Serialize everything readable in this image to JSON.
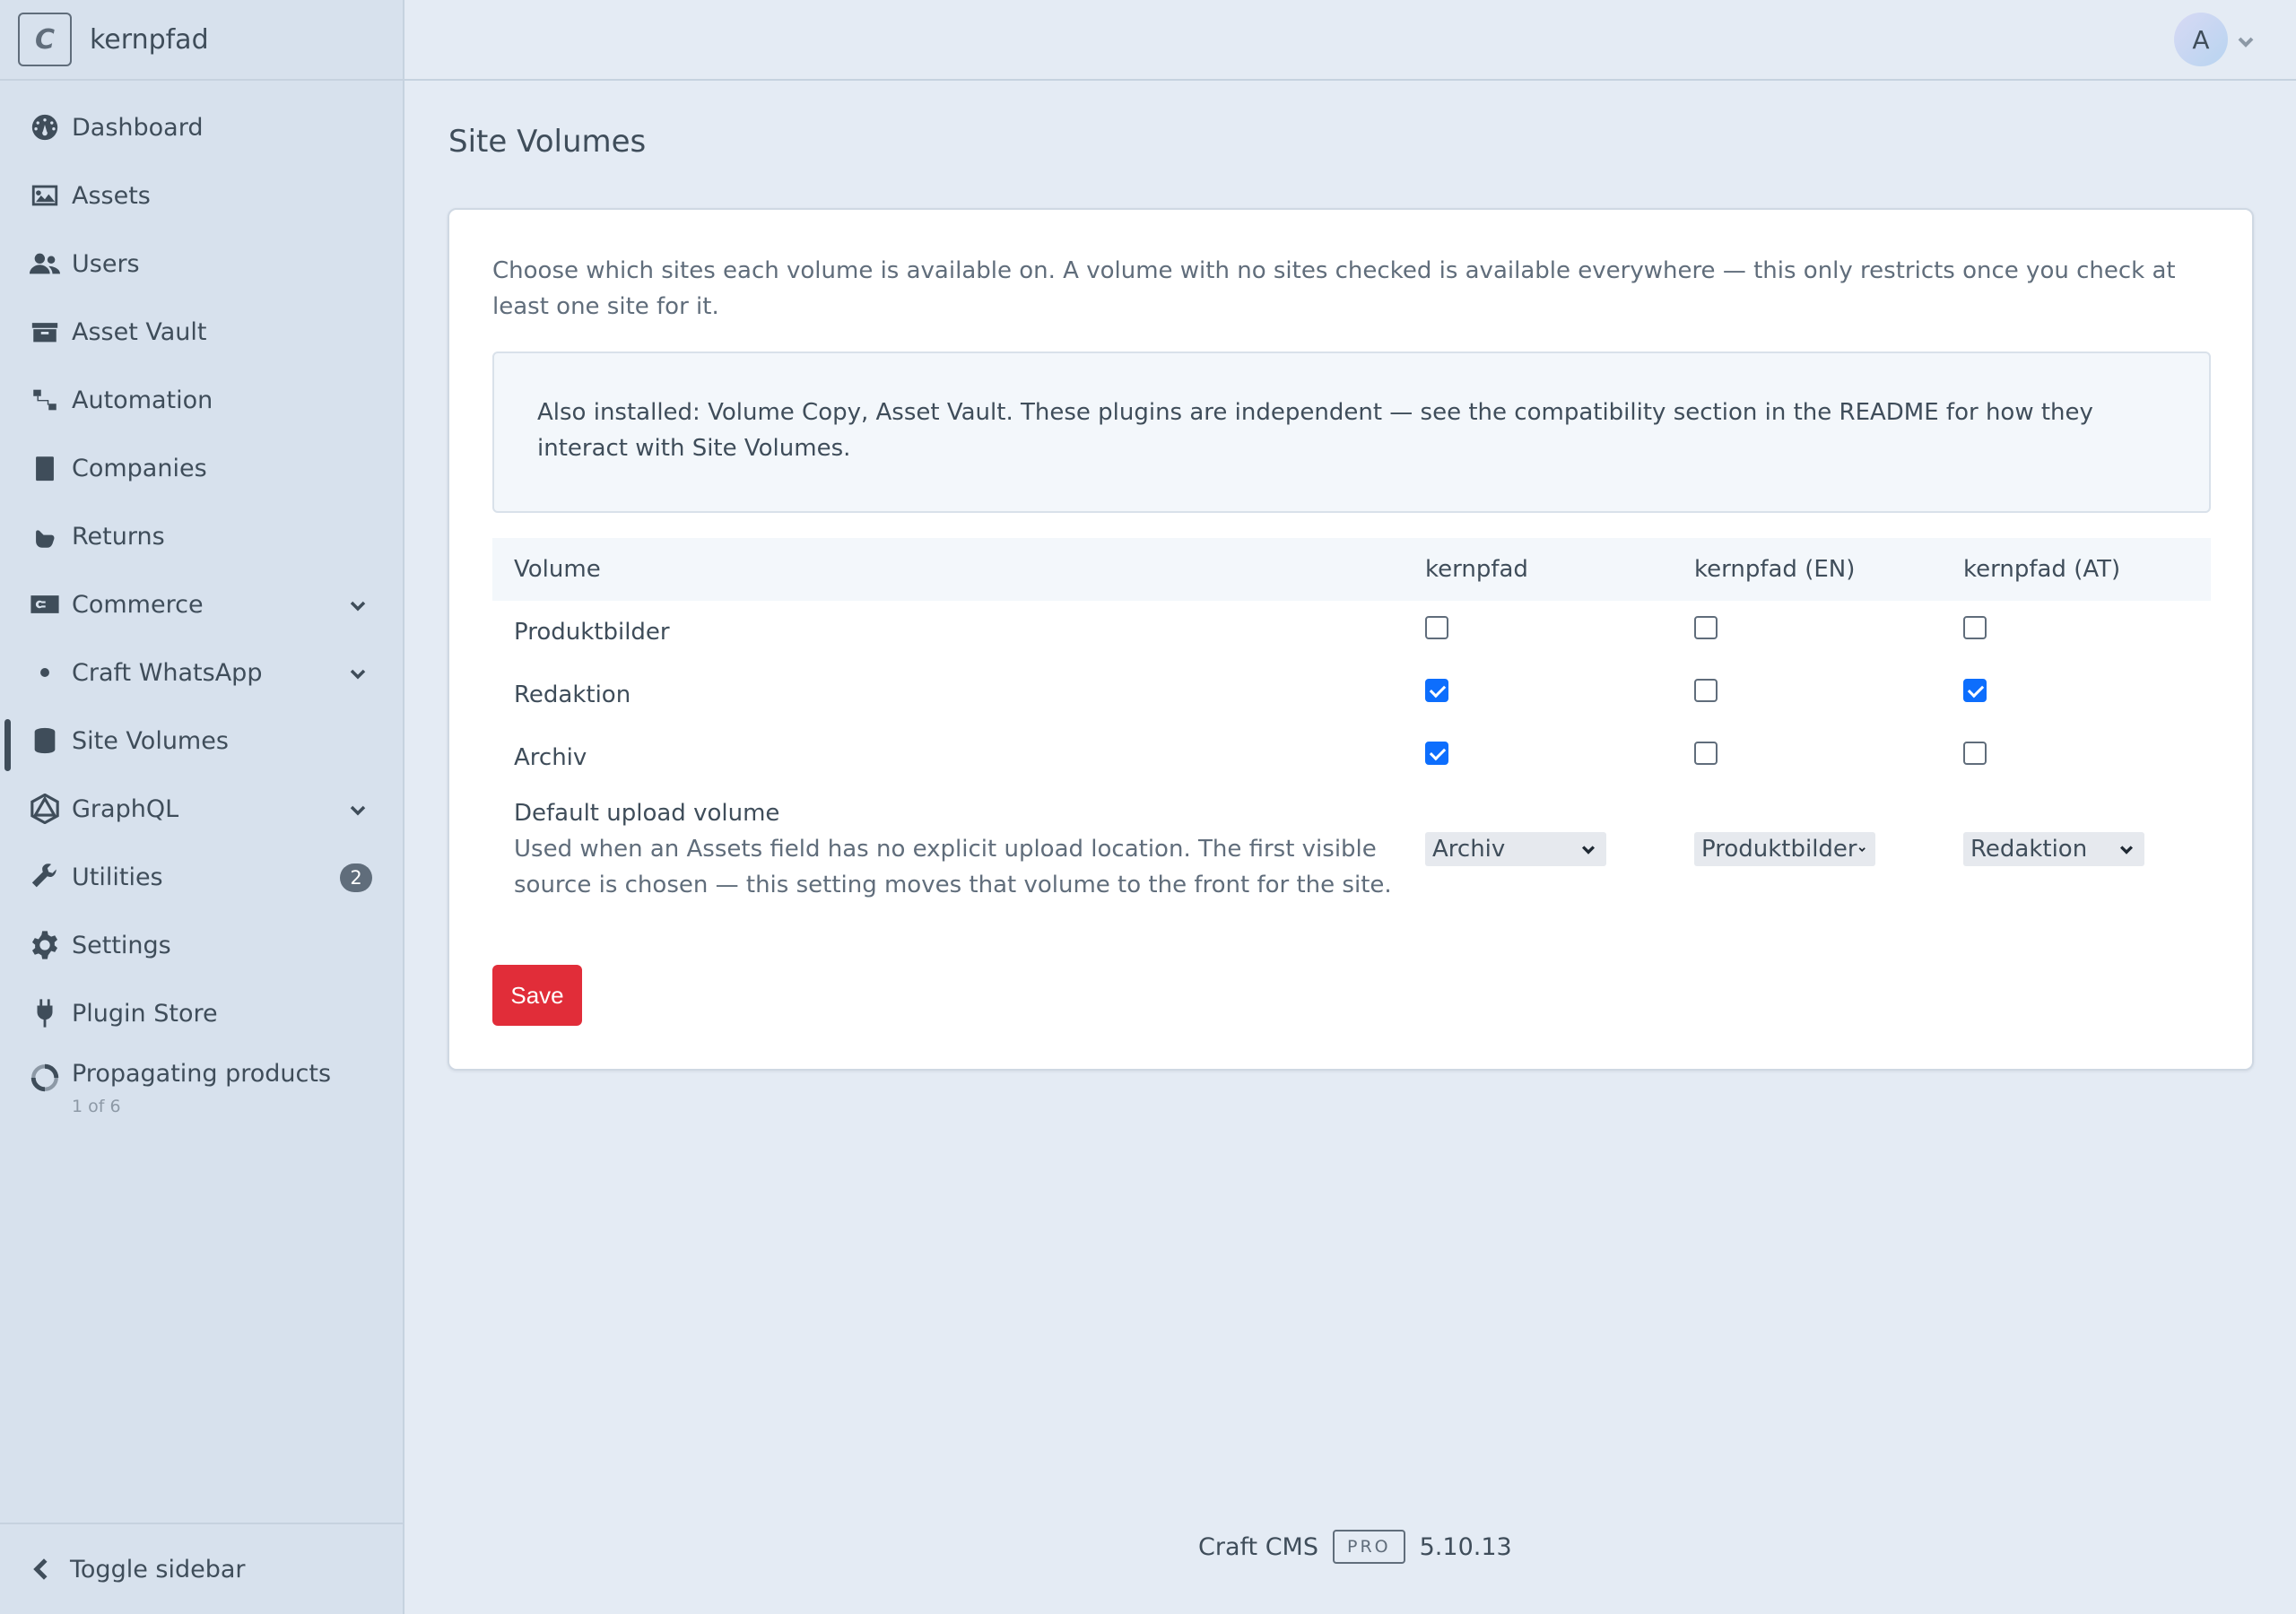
{
  "sidebar": {
    "logo_letter": "C",
    "site_name": "kernpfad",
    "items": [
      {
        "label": "Dashboard",
        "icon": "gauge-icon"
      },
      {
        "label": "Assets",
        "icon": "image-icon"
      },
      {
        "label": "Users",
        "icon": "users-icon"
      },
      {
        "label": "Asset Vault",
        "icon": "archive-icon"
      },
      {
        "label": "Automation",
        "icon": "workflow-icon"
      },
      {
        "label": "Companies",
        "icon": "building-icon"
      },
      {
        "label": "Returns",
        "icon": "hand-icon"
      },
      {
        "label": "Commerce",
        "icon": "commerce-icon"
      },
      {
        "label": "Craft WhatsApp",
        "icon": "dot-icon"
      },
      {
        "label": "Site Volumes",
        "icon": "database-icon"
      },
      {
        "label": "GraphQL",
        "icon": "graphql-icon"
      },
      {
        "label": "Utilities",
        "icon": "wrench-icon",
        "badge": "2"
      },
      {
        "label": "Settings",
        "icon": "gear-icon"
      },
      {
        "label": "Plugin Store",
        "icon": "plug-icon"
      }
    ],
    "job": {
      "title": "Propagating products",
      "progress": "1 of 6"
    },
    "toggle_label": "Toggle sidebar"
  },
  "header": {
    "avatar_letter": "A"
  },
  "main": {
    "title": "Site Volumes",
    "intro": "Choose which sites each volume is available on. A volume with no sites checked is available everywhere — this only restricts once you check at least one site for it.",
    "notice": "Also installed: Volume Copy, Asset Vault. These plugins are independent — see the compatibility section in the README for how they interact with Site Volumes.",
    "table": {
      "headers": [
        "Volume",
        "kernpfad",
        "kernpfad (EN)",
        "kernpfad (AT)"
      ],
      "rows": [
        {
          "name": "Produktbilder",
          "checks": [
            false,
            false,
            false
          ]
        },
        {
          "name": "Redaktion",
          "checks": [
            true,
            false,
            true
          ]
        },
        {
          "name": "Archiv",
          "checks": [
            true,
            false,
            false
          ]
        }
      ],
      "upload": {
        "label": "Default upload volume",
        "description": "Used when an Assets field has no explicit upload location. The first visible source is chosen — this setting moves that volume to the front for the site.",
        "selects": [
          "Archiv",
          "Produktbilder",
          "Redaktion"
        ]
      }
    },
    "save_label": "Save"
  },
  "footer": {
    "product": "Craft CMS",
    "edition": "PRO",
    "version": "5.10.13"
  },
  "colors": {
    "accent": "#e12d39",
    "checkbox": "#0d6efd",
    "sidebar_bg": "#d7e1ed",
    "page_bg": "#e4ebf4"
  }
}
